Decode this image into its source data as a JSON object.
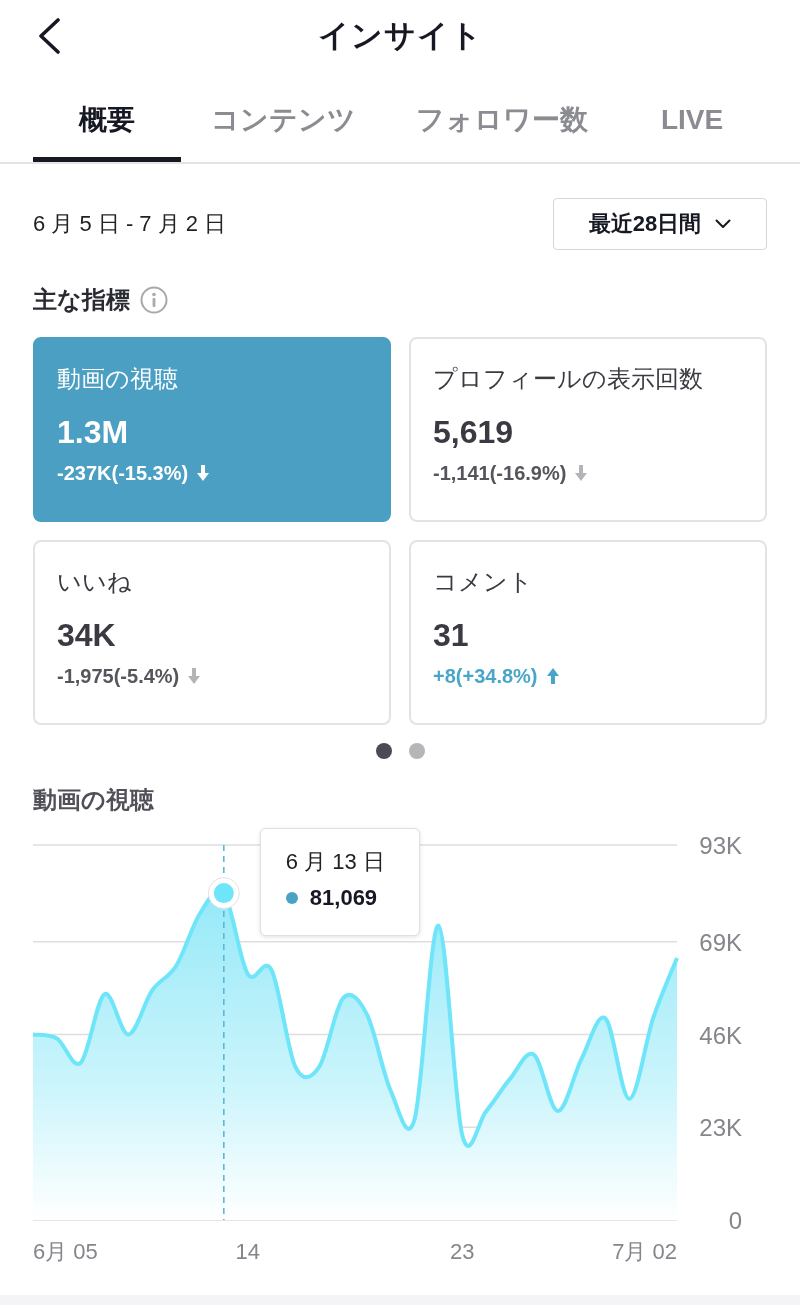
{
  "header": {
    "title": "インサイト"
  },
  "tabs": [
    {
      "label": "概要",
      "selected": true
    },
    {
      "label": "コンテンツ",
      "selected": false
    },
    {
      "label": "フォロワー数",
      "selected": false
    },
    {
      "label": "LIVE",
      "selected": false
    }
  ],
  "date_range": {
    "label": "6 月 5 日 - 7 月 2 日",
    "period": "最近28日間"
  },
  "key_metrics": {
    "title": "主な指標",
    "cards": [
      {
        "title": "動画の視聴",
        "value": "1.3M",
        "change": "-237K(-15.3%)",
        "rising": false,
        "selected": true
      },
      {
        "title": "プロフィールの表示回数",
        "value": "5,619",
        "change": "-1,141(-16.9%)",
        "rising": false,
        "selected": false
      },
      {
        "title": "いいね",
        "value": "34K",
        "change": "-1,975(-5.4%)",
        "rising": false,
        "selected": false
      },
      {
        "title": "コメント",
        "value": "31",
        "change": "+8(+34.8%)",
        "rising": true,
        "selected": false
      }
    ]
  },
  "pager": [
    {
      "selected": true
    },
    {
      "selected": false
    }
  ],
  "chart_section": {
    "chart_data": {
      "type": "area",
      "title": "動画の視聴",
      "x": [
        5,
        6,
        7,
        8,
        9,
        10,
        11,
        12,
        13,
        14,
        15,
        16,
        17,
        18,
        19,
        20,
        21,
        22,
        23,
        24,
        25,
        26,
        27,
        28,
        29,
        30,
        31,
        32
      ],
      "series": [
        {
          "color": "#6fe5f9",
          "values": [
            46000,
            45000,
            39000,
            56000,
            46000,
            57000,
            63000,
            76000,
            81069,
            61000,
            62000,
            38000,
            38000,
            55000,
            51000,
            32000,
            25000,
            73000,
            21000,
            27000,
            35000,
            41000,
            27000,
            40000,
            50000,
            30000,
            50000,
            65000
          ]
        }
      ],
      "xlim": [
        5,
        32
      ],
      "ylim": [
        0,
        93000
      ],
      "xticks": [
        {
          "value": 5,
          "label": "6月 05"
        },
        {
          "value": 14,
          "label": "14"
        },
        {
          "value": 23,
          "label": "23"
        },
        {
          "value": 32,
          "label": "7月 02"
        }
      ],
      "yticks": [
        {
          "value": 0,
          "label": "0"
        },
        {
          "value": 23000,
          "label": "23K"
        },
        {
          "value": 46000,
          "label": "46K"
        },
        {
          "value": 69000,
          "label": "69K"
        },
        {
          "value": 93000,
          "label": "93K"
        }
      ],
      "grid": true,
      "ref_lines": [
        {
          "axis": "x",
          "value": 13
        }
      ],
      "annotations": [
        "6 月 13 日",
        "81,069"
      ]
    }
  }
}
